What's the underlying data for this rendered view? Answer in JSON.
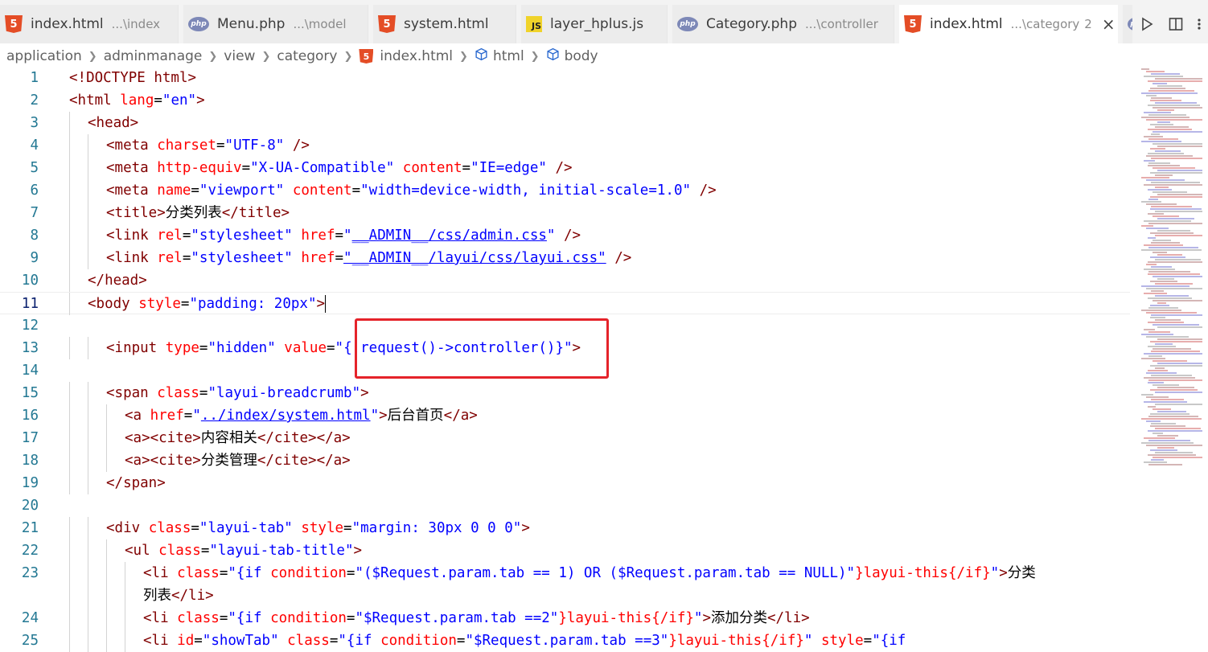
{
  "tabs": [
    {
      "id": "t1",
      "icon": "html-file-icon",
      "name": "index.html",
      "desc": "...\\index",
      "active": false
    },
    {
      "id": "t2",
      "icon": "php-file-icon",
      "name": "Menu.php",
      "desc": "...\\model",
      "active": false
    },
    {
      "id": "t3",
      "icon": "html-file-icon",
      "name": "system.html",
      "desc": "",
      "active": false
    },
    {
      "id": "t4",
      "icon": "js-file-icon",
      "name": "layer_hplus.js",
      "desc": "",
      "active": false
    },
    {
      "id": "t5",
      "icon": "php-file-icon",
      "name": "Category.php",
      "desc": "...\\controller",
      "active": false
    },
    {
      "id": "t6",
      "icon": "html-file-icon",
      "name": "index.html",
      "desc": "...\\category",
      "badge": "2",
      "active": true
    }
  ],
  "tab_close_glyph": "×",
  "breadcrumb": [
    "application",
    "adminmanage",
    "view",
    "category",
    "index.html",
    "html",
    "body"
  ],
  "icons": {
    "html_label": "5",
    "php_label": "php",
    "js_label": "JS"
  },
  "code_lines": [
    {
      "n": "1",
      "tokens": [
        [
          "t",
          "<!DOCTYPE html>"
        ]
      ]
    },
    {
      "n": "2",
      "tokens": [
        [
          "t",
          "<html "
        ],
        [
          "a",
          "lang"
        ],
        [
          "p",
          "="
        ],
        [
          "v",
          "\"en\""
        ],
        [
          "t",
          ">"
        ]
      ]
    },
    {
      "n": "3",
      "tokens": [
        [
          "t",
          "<head>"
        ]
      ]
    },
    {
      "n": "4",
      "tokens": [
        [
          "t",
          "<meta "
        ],
        [
          "a",
          "charset"
        ],
        [
          "p",
          "="
        ],
        [
          "v",
          "\"UTF-8\""
        ],
        [
          "t",
          " />"
        ]
      ]
    },
    {
      "n": "5",
      "tokens": [
        [
          "t",
          "<meta "
        ],
        [
          "a",
          "http-equiv"
        ],
        [
          "p",
          "="
        ],
        [
          "v",
          "\"X-UA-Compatible\""
        ],
        [
          "a",
          " content"
        ],
        [
          "p",
          "="
        ],
        [
          "v",
          "\"IE=edge\""
        ],
        [
          "t",
          " />"
        ]
      ]
    },
    {
      "n": "6",
      "tokens": [
        [
          "t",
          "<meta "
        ],
        [
          "a",
          "name"
        ],
        [
          "p",
          "="
        ],
        [
          "v",
          "\"viewport\""
        ],
        [
          "a",
          " content"
        ],
        [
          "p",
          "="
        ],
        [
          "v",
          "\"width=device-width, initial-scale=1.0\""
        ],
        [
          "t",
          " />"
        ]
      ]
    },
    {
      "n": "7",
      "tokens": [
        [
          "t",
          "<title>"
        ],
        [
          "p",
          "分类列表"
        ],
        [
          "t",
          "</title>"
        ]
      ]
    },
    {
      "n": "8",
      "tokens": [
        [
          "t",
          "<link "
        ],
        [
          "a",
          "rel"
        ],
        [
          "p",
          "="
        ],
        [
          "v",
          "\"stylesheet\""
        ],
        [
          "a",
          " href"
        ],
        [
          "p",
          "="
        ],
        [
          "v",
          "\""
        ],
        [
          "vu",
          "__ADMIN__/css/admin.css"
        ],
        [
          "v",
          "\""
        ],
        [
          "t",
          " />"
        ]
      ]
    },
    {
      "n": "9",
      "tokens": [
        [
          "t",
          "<link "
        ],
        [
          "a",
          "rel"
        ],
        [
          "p",
          "="
        ],
        [
          "v",
          "\"stylesheet\""
        ],
        [
          "a",
          " href"
        ],
        [
          "p",
          "="
        ],
        [
          "vu",
          "\"__ADMIN__/layui/css/layui.css\""
        ],
        [
          "t",
          " />"
        ]
      ]
    },
    {
      "n": "10",
      "tokens": [
        [
          "t",
          "</head>"
        ]
      ]
    },
    {
      "n": "11",
      "tokens": [
        [
          "t",
          "<body "
        ],
        [
          "a",
          "style"
        ],
        [
          "p",
          "="
        ],
        [
          "v",
          "\"padding: 20px\""
        ],
        [
          "t",
          ">"
        ]
      ]
    },
    {
      "n": "12",
      "tokens": []
    },
    {
      "n": "13",
      "tokens": [
        [
          "t",
          "<input "
        ],
        [
          "a",
          "type"
        ],
        [
          "p",
          "="
        ],
        [
          "v",
          "\"hidden\""
        ],
        [
          "a",
          " value"
        ],
        [
          "p",
          "="
        ],
        [
          "v",
          "\"{:request()->controller()}\""
        ],
        [
          "t",
          ">"
        ]
      ]
    },
    {
      "n": "14",
      "tokens": []
    },
    {
      "n": "15",
      "tokens": [
        [
          "t",
          "<span "
        ],
        [
          "a",
          "class"
        ],
        [
          "p",
          "="
        ],
        [
          "v",
          "\"layui-breadcrumb\""
        ],
        [
          "t",
          ">"
        ]
      ]
    },
    {
      "n": "16",
      "tokens": [
        [
          "t",
          "<a "
        ],
        [
          "a",
          "href"
        ],
        [
          "p",
          "="
        ],
        [
          "v",
          "\""
        ],
        [
          "vu",
          "../index/system.html"
        ],
        [
          "v",
          "\""
        ],
        [
          "t",
          ">"
        ],
        [
          "p",
          "后台首页"
        ],
        [
          "t",
          "</a>"
        ]
      ]
    },
    {
      "n": "17",
      "tokens": [
        [
          "t",
          "<a><cite>"
        ],
        [
          "p",
          "内容相关"
        ],
        [
          "t",
          "</cite></a>"
        ]
      ]
    },
    {
      "n": "18",
      "tokens": [
        [
          "t",
          "<a><cite>"
        ],
        [
          "p",
          "分类管理"
        ],
        [
          "t",
          "</cite></a>"
        ]
      ]
    },
    {
      "n": "19",
      "tokens": [
        [
          "t",
          "</span>"
        ]
      ]
    },
    {
      "n": "20",
      "tokens": []
    },
    {
      "n": "21",
      "tokens": [
        [
          "t",
          "<div "
        ],
        [
          "a",
          "class"
        ],
        [
          "p",
          "="
        ],
        [
          "v",
          "\"layui-tab\""
        ],
        [
          "a",
          " style"
        ],
        [
          "p",
          "="
        ],
        [
          "v",
          "\"margin: 30px 0 0 0\""
        ],
        [
          "t",
          ">"
        ]
      ]
    },
    {
      "n": "22",
      "tokens": [
        [
          "t",
          "<ul "
        ],
        [
          "a",
          "class"
        ],
        [
          "p",
          "="
        ],
        [
          "v",
          "\"layui-tab-title\""
        ],
        [
          "t",
          ">"
        ]
      ]
    },
    {
      "n": "23",
      "tokens": [
        [
          "t",
          "<li "
        ],
        [
          "a",
          "class"
        ],
        [
          "p",
          "="
        ],
        [
          "v",
          "\"{if "
        ],
        [
          "a",
          "condition"
        ],
        [
          "p",
          "="
        ],
        [
          "v",
          "\"($Request.param.tab == 1) OR ($Request.param.tab == NULL)\""
        ],
        [
          "a",
          "}layui-this{/if}"
        ],
        [
          "v",
          "\""
        ],
        [
          "t",
          ">"
        ],
        [
          "p",
          "分类"
        ]
      ]
    },
    {
      "n": "",
      "tokens": [
        [
          "p",
          "列表"
        ],
        [
          "t",
          "</li>"
        ]
      ]
    },
    {
      "n": "24",
      "tokens": [
        [
          "t",
          "<li "
        ],
        [
          "a",
          "class"
        ],
        [
          "p",
          "="
        ],
        [
          "v",
          "\"{if "
        ],
        [
          "a",
          "condition"
        ],
        [
          "p",
          "="
        ],
        [
          "v",
          "\"$Request.param.tab ==2\""
        ],
        [
          "a",
          "}layui-this{/if}"
        ],
        [
          "v",
          "\""
        ],
        [
          "t",
          ">"
        ],
        [
          "p",
          "添加分类"
        ],
        [
          "t",
          "</li>"
        ]
      ]
    },
    {
      "n": "25",
      "tokens": [
        [
          "t",
          "<li "
        ],
        [
          "a",
          "id"
        ],
        [
          "p",
          "="
        ],
        [
          "v",
          "\"showTab\""
        ],
        [
          "a",
          " class"
        ],
        [
          "p",
          "="
        ],
        [
          "v",
          "\"{if "
        ],
        [
          "a",
          "condition"
        ],
        [
          "p",
          "="
        ],
        [
          "v",
          "\"$Request.param.tab ==3\""
        ],
        [
          "a",
          "}layui-this{/if}"
        ],
        [
          "v",
          "\""
        ],
        [
          "a",
          " style"
        ],
        [
          "p",
          "="
        ],
        [
          "v",
          "\"{if"
        ]
      ]
    }
  ]
}
